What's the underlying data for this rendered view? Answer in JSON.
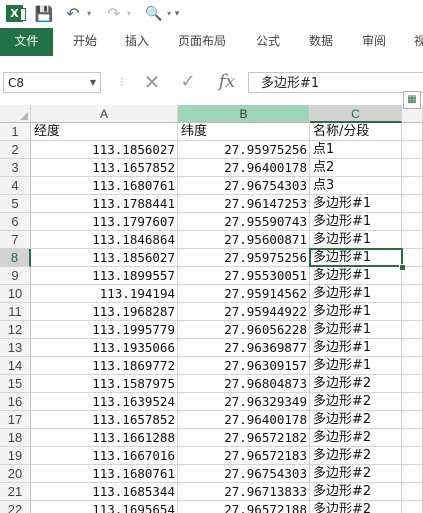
{
  "titlebar": {
    "app_icon": "excel-logo-icon",
    "app_logo_text": "X",
    "save_icon": "save-icon",
    "undo_icon": "undo-icon",
    "redo_icon": "redo-icon",
    "print_preview_icon": "print-preview-icon",
    "customize_icon": "customize-toolbar-icon"
  },
  "ribbon": {
    "tabs": [
      "文件",
      "开始",
      "插入",
      "页面布局",
      "公式",
      "数据",
      "审阅",
      "视"
    ]
  },
  "formula_bar": {
    "name_box": "C8",
    "content": "多边形#1"
  },
  "sheet": {
    "columns": [
      "A",
      "B",
      "C"
    ],
    "selected_column": "C",
    "selected_row": "8",
    "active_cell": "C8",
    "rows": [
      {
        "n": "1",
        "a": "经度",
        "b": "纬度",
        "c": "名称/分段"
      },
      {
        "n": "2",
        "a": "113.1856027",
        "b": "27.95975256",
        "c": "点1"
      },
      {
        "n": "3",
        "a": "113.1657852",
        "b": "27.96400178",
        "c": "点2"
      },
      {
        "n": "4",
        "a": "113.1680761",
        "b": "27.96754303",
        "c": "点3"
      },
      {
        "n": "5",
        "a": "113.1788441",
        "b": "27.96147253",
        "c": "多边形#1"
      },
      {
        "n": "6",
        "a": "113.1797607",
        "b": "27.95590743",
        "c": "多边形#1"
      },
      {
        "n": "7",
        "a": "113.1846864",
        "b": "27.95600871",
        "c": "多边形#1"
      },
      {
        "n": "8",
        "a": "113.1856027",
        "b": "27.95975256",
        "c": "多边形#1"
      },
      {
        "n": "9",
        "a": "113.1899557",
        "b": "27.95530051",
        "c": "多边形#1"
      },
      {
        "n": "10",
        "a": "113.194194",
        "b": "27.95914562",
        "c": "多边形#1"
      },
      {
        "n": "11",
        "a": "113.1968287",
        "b": "27.95944922",
        "c": "多边形#1"
      },
      {
        "n": "12",
        "a": "113.1995779",
        "b": "27.96056228",
        "c": "多边形#1"
      },
      {
        "n": "13",
        "a": "113.1935066",
        "b": "27.96369877",
        "c": "多边形#1"
      },
      {
        "n": "14",
        "a": "113.1869772",
        "b": "27.96309157",
        "c": "多边形#1"
      },
      {
        "n": "15",
        "a": "113.1587975",
        "b": "27.96804873",
        "c": "多边形#2"
      },
      {
        "n": "16",
        "a": "113.1639524",
        "b": "27.96329349",
        "c": "多边形#2"
      },
      {
        "n": "17",
        "a": "113.1657852",
        "b": "27.96400178",
        "c": "多边形#2"
      },
      {
        "n": "18",
        "a": "113.1661288",
        "b": "27.96572182",
        "c": "多边形#2"
      },
      {
        "n": "19",
        "a": "113.1667016",
        "b": "27.96572183",
        "c": "多边形#2"
      },
      {
        "n": "20",
        "a": "113.1680761",
        "b": "27.96754303",
        "c": "多边形#2"
      },
      {
        "n": "21",
        "a": "113.1685344",
        "b": "27.96713833",
        "c": "多边形#2"
      },
      {
        "n": "22",
        "a": "113.1695654",
        "b": "27.96572188",
        "c": "多边形#2"
      }
    ]
  },
  "quick_analysis_icon": "quick-analysis-icon",
  "colors": {
    "excel_green": "#217346",
    "selected_col_header": "#9fd5b7"
  }
}
